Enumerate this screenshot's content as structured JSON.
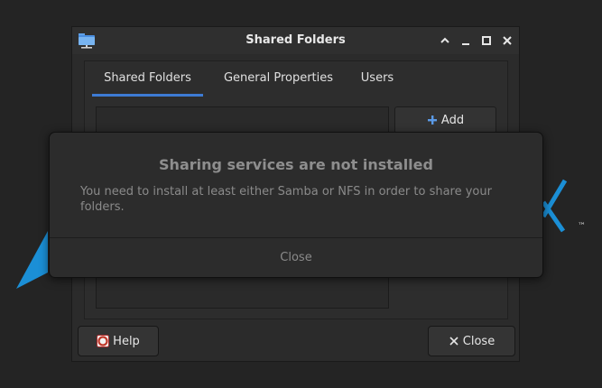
{
  "window": {
    "title": "Shared Folders"
  },
  "tabs": [
    {
      "label": "Shared Folders",
      "active": true
    },
    {
      "label": "General Properties",
      "active": false
    },
    {
      "label": "Users",
      "active": false
    }
  ],
  "buttons": {
    "add": "Add",
    "help": "Help",
    "close": "Close"
  },
  "dialog": {
    "title": "Sharing services are not installed",
    "message": "You need to install at least either Samba or NFS in order to share your folders.",
    "close": "Close"
  },
  "wallpaper": {
    "trademark": "™"
  },
  "colors": {
    "accent": "#3d7bd4",
    "logo_blue": "#1b8fd6"
  },
  "icons": {
    "app": "network-folder-icon",
    "add": "plus-icon",
    "help": "lifebuoy-icon",
    "close": "x-icon"
  }
}
